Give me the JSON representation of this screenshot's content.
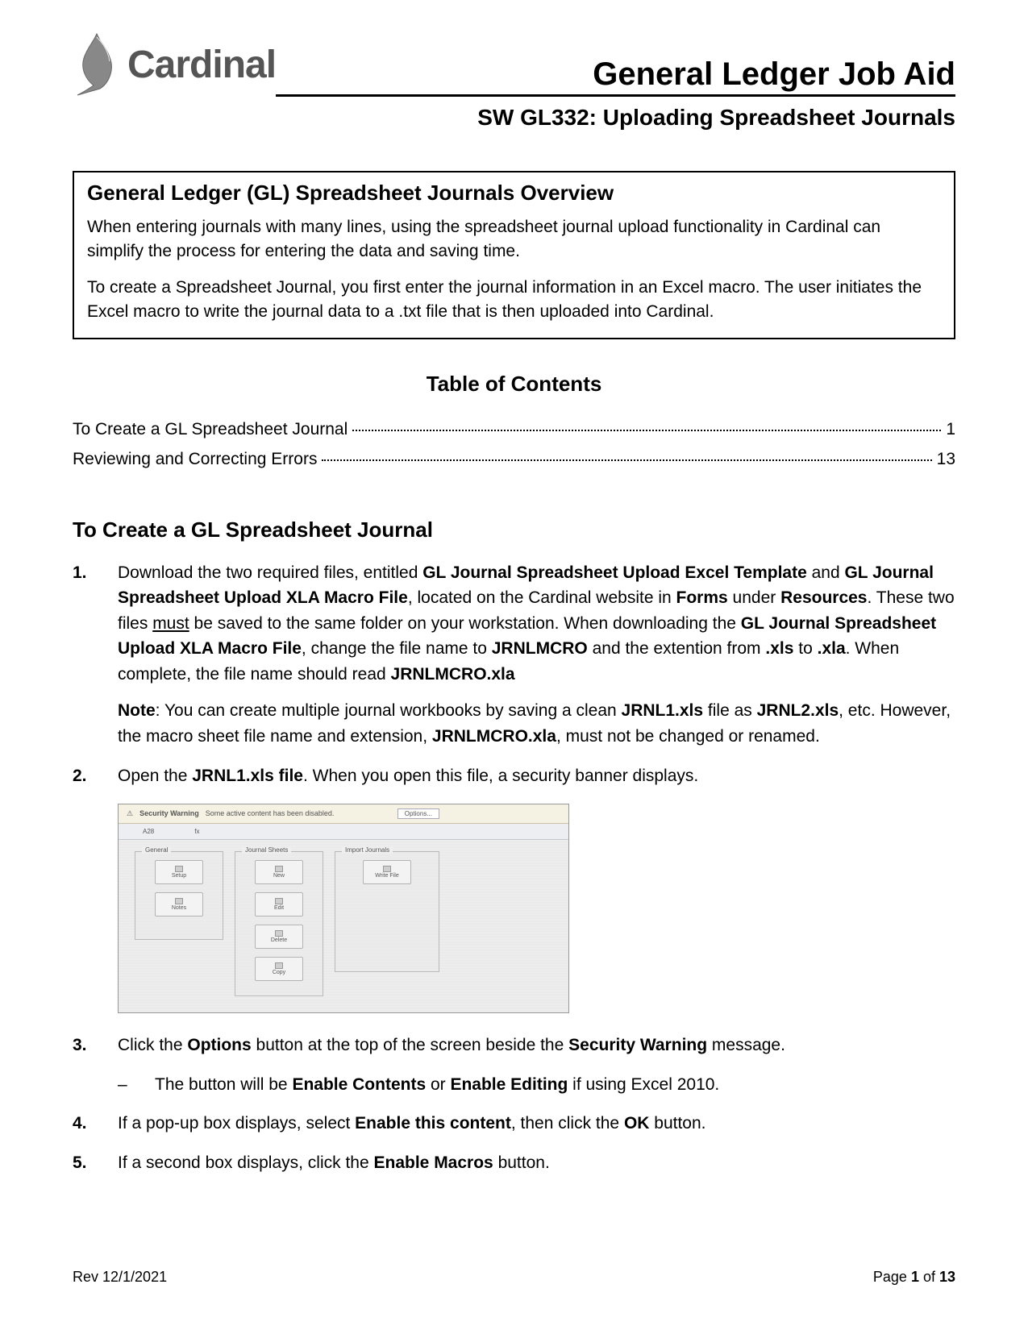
{
  "brand": "Cardinal",
  "doc_title": "General Ledger Job Aid",
  "doc_subtitle": "SW GL332: Uploading Spreadsheet Journals",
  "overview": {
    "title": "General Ledger (GL) Spreadsheet Journals Overview",
    "p1": "When entering journals with many lines, using the spreadsheet journal upload functionality in Cardinal can simplify the process for entering the data and saving time.",
    "p2": "To create a Spreadsheet Journal, you first enter the journal information in an Excel macro.  The user initiates the Excel macro to write the journal data to a .txt file that is then uploaded into Cardinal."
  },
  "toc": {
    "title": "Table of Contents",
    "rows": [
      {
        "label": "To Create a GL Spreadsheet Journal",
        "page": "1"
      },
      {
        "label": "Reviewing and Correcting Errors",
        "page": "13"
      }
    ]
  },
  "section_title": "To Create a GL Spreadsheet Journal",
  "steps": {
    "s1_num": "1.",
    "s1_a": "Download the two required files, entitled ",
    "s1_b": "GL Journal Spreadsheet Upload Excel Template",
    "s1_c": " and ",
    "s1_d": "GL Journal Spreadsheet Upload XLA Macro File",
    "s1_e": ", located on the Cardinal website in ",
    "s1_f": "Forms",
    "s1_g": " under ",
    "s1_h": "Resources",
    "s1_i": ".  These two files ",
    "s1_j": "must",
    "s1_k": " be saved to the same folder on your workstation.  When downloading the ",
    "s1_l": "GL Journal Spreadsheet Upload XLA Macro File",
    "s1_m": ", change the file name to ",
    "s1_n": "JRNLMCRO",
    "s1_o": " and the extention from ",
    "s1_p": ".xls",
    "s1_q": " to ",
    "s1_r": ".xla",
    "s1_s": ".  When complete, the file name should read ",
    "s1_t": "JRNLMCRO.xla",
    "s1_note_a": "Note",
    "s1_note_b": ": You can create multiple journal workbooks by saving a clean ",
    "s1_note_c": "JRNL1.xls",
    "s1_note_d": " file as ",
    "s1_note_e": "JRNL2.xls",
    "s1_note_f": ", etc.  However, the macro sheet file name and extension, ",
    "s1_note_g": "JRNLMCRO.xla",
    "s1_note_h": ", must not be changed or renamed.",
    "s2_num": "2.",
    "s2_a": "Open the ",
    "s2_b": "JRNL1.xls file",
    "s2_c": ".  When you open this file, a security banner displays.",
    "s3_num": "3.",
    "s3_a": "Click the ",
    "s3_b": "Options",
    "s3_c": " button at the top of the screen beside the ",
    "s3_d": "Security Warning",
    "s3_e": " message.",
    "s3_sub_dash": "–",
    "s3_sub_a": "The button will be ",
    "s3_sub_b": "Enable Contents",
    "s3_sub_c": " or ",
    "s3_sub_d": "Enable Editing",
    "s3_sub_e": " if using Excel 2010.",
    "s4_num": "4.",
    "s4_a": "If a pop-up box displays, select ",
    "s4_b": "Enable this content",
    "s4_c": ", then click the ",
    "s4_d": "OK",
    "s4_e": " button.",
    "s5_num": "5.",
    "s5_a": "If a second box displays, click the ",
    "s5_b": "Enable Macros",
    "s5_c": " button."
  },
  "screenshot": {
    "banner_warn": "Security Warning",
    "banner_text": "Some active content has been disabled.",
    "banner_btn": "Options...",
    "cell_ref": "A28",
    "fx": "fx",
    "g1": "General",
    "g2": "Journal Sheets",
    "g3": "Import Journals",
    "btn_setup": "Setup",
    "btn_notes": "Notes",
    "btn_new": "New",
    "btn_edit": "Edit",
    "btn_delete": "Delete",
    "btn_copy": "Copy",
    "btn_write": "Write File"
  },
  "footer": {
    "rev": "Rev 12/1/2021",
    "page_a": "Page ",
    "page_b": "1",
    "page_c": " of ",
    "page_d": "13"
  }
}
